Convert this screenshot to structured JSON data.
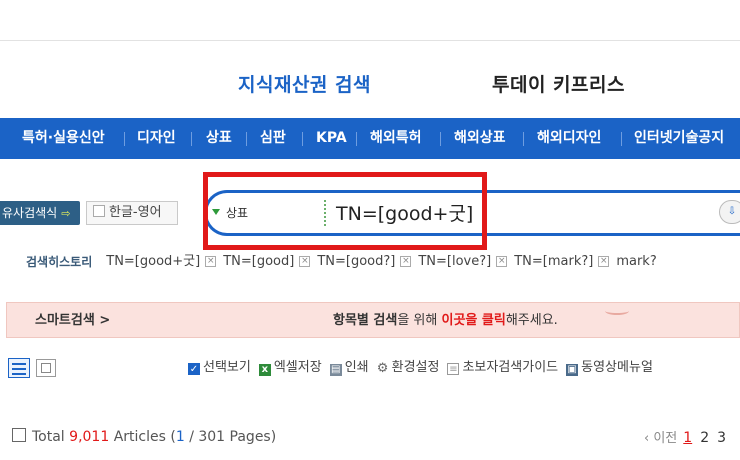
{
  "header": {
    "active_tab": "지식재산권 검색",
    "other_tab": "투데이 키프리스"
  },
  "nav": {
    "items": [
      "특허·실용신안",
      "디자인",
      "상표",
      "심판",
      "KPA",
      "해외특허",
      "해외상표",
      "해외디자인",
      "인터넷기술공지"
    ]
  },
  "search": {
    "similar_button": "유사검색식",
    "lang_toggle": "한글-영어",
    "category": "상표",
    "query": "TN=[good+굿]"
  },
  "history": {
    "label": "검색히스토리",
    "items": [
      "TN=[good+굿]",
      "TN=[good]",
      "TN=[good?]",
      "TN=[love?]",
      "TN=[mark?]",
      "mark?"
    ]
  },
  "smart": {
    "label": "스마트검색 >",
    "msg_bold": "항목별 검색",
    "msg_part1": "을 위해 ",
    "msg_red": "이곳을 클릭",
    "msg_part2": "해주세요."
  },
  "toolbar": {
    "select_view": "선택보기",
    "excel_save": "엑셀저장",
    "print": "인쇄",
    "settings": "환경설정",
    "beginner_guide": "초보자검색가이드",
    "video_manual": "동영상메뉴얼"
  },
  "results": {
    "prefix": "Total ",
    "count": "9,011",
    "articles": " Articles (",
    "page_current": "1",
    "page_total": " / 301 Pages)"
  },
  "pager": {
    "prev": "‹ 이전",
    "pages": [
      "1",
      "2",
      "3"
    ]
  },
  "colors": {
    "primary_blue": "#1b63c6",
    "highlight_red": "#e11919",
    "smart_bar_bg": "#fbe2de"
  }
}
